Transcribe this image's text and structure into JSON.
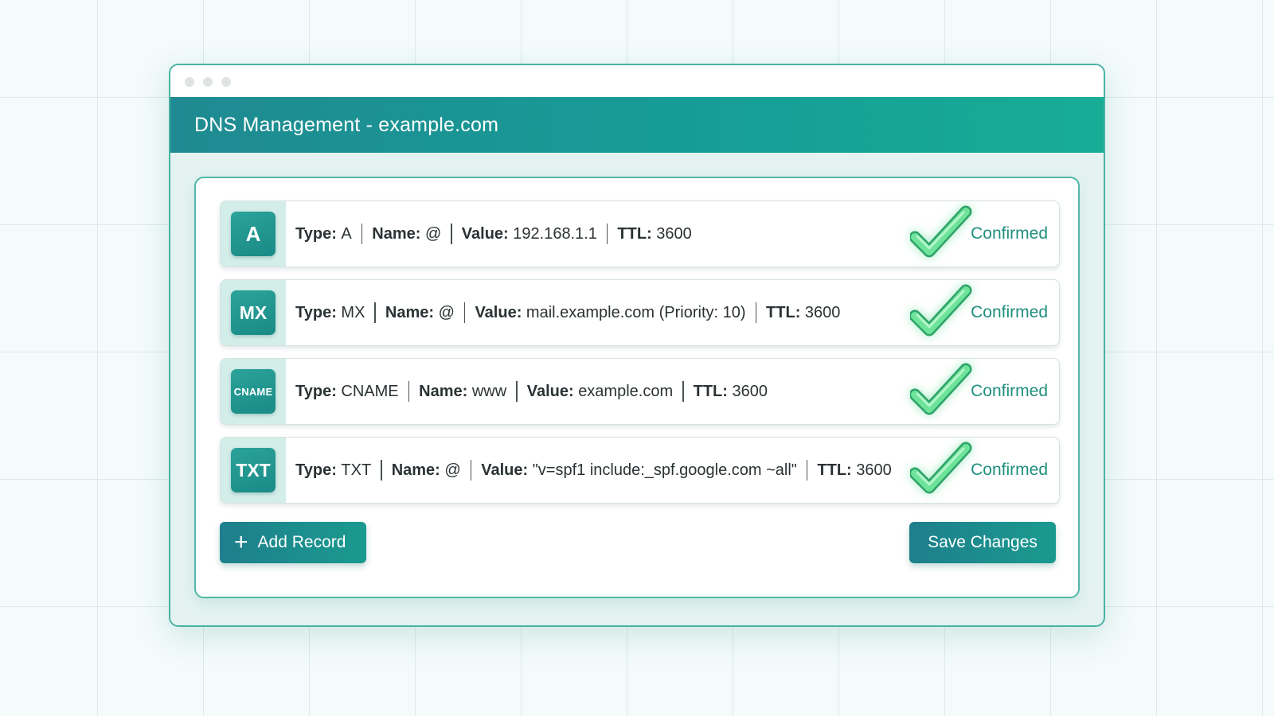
{
  "window": {
    "title": "DNS Management - example.com"
  },
  "records": [
    {
      "badge": "A",
      "type_label": "Type:",
      "type": "A",
      "name_label": "Name:",
      "name": "@",
      "value_label": "Value:",
      "value": "192.168.1.1",
      "ttl_label": "TTL:",
      "ttl": "3600",
      "status": "Confirmed"
    },
    {
      "badge": "MX",
      "type_label": "Type:",
      "type": "MX",
      "name_label": "Name:",
      "name": "@",
      "value_label": "Value:",
      "value": "mail.example.com (Priority: 10)",
      "ttl_label": "TTL:",
      "ttl": "3600",
      "status": "Confirmed"
    },
    {
      "badge": "CNAME",
      "type_label": "Type:",
      "type": "CNAME",
      "name_label": "Name:",
      "name": "www",
      "value_label": "Value:",
      "value": "example.com",
      "ttl_label": "TTL:",
      "ttl": "3600",
      "status": "Confirmed"
    },
    {
      "badge": "TXT",
      "type_label": "Type:",
      "type": "TXT",
      "name_label": "Name:",
      "name": "@",
      "value_label": "Value:",
      "value": "\"v=spf1 include:_spf.google.com ~all\"",
      "ttl_label": "TTL:",
      "ttl": "3600",
      "status": "Confirmed"
    }
  ],
  "actions": {
    "add_icon": "plus-icon",
    "add_label": "Add Record",
    "save_label": "Save Changes"
  },
  "icons": {
    "status": "check-icon"
  },
  "colors": {
    "accent": "#1a9a8f",
    "header": "#169c97",
    "status_text": "#1f8f7e",
    "check": "#5fd98a"
  }
}
